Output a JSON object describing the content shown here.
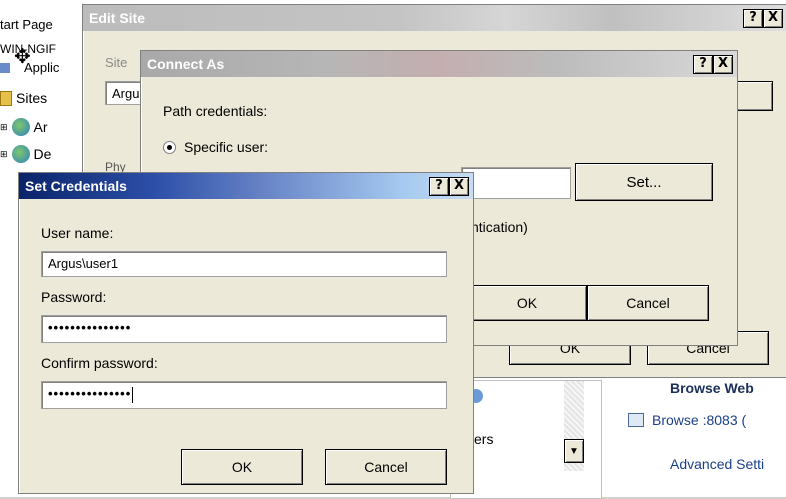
{
  "background": {
    "tree": {
      "start_page": "tart Page",
      "server": "WIN-NGIF",
      "app_pools": "Applic",
      "sites": "Sites",
      "site1": "Ar",
      "site2": "De"
    },
    "right_panel": {
      "browse_header": "Browse Web",
      "browse_link": "Browse :8083 (",
      "advanced_link": "Advanced Setti"
    },
    "list_text": "sers"
  },
  "edit_site": {
    "title": "Edit Site",
    "help_btn": "?",
    "close_btn": "X",
    "site_label": "Site",
    "site_value": "Argu",
    "phys_label": "Phy",
    "ok": "OK",
    "cancel": "Cancel"
  },
  "connect_as": {
    "title": "Connect As",
    "help_btn": "?",
    "close_btn": "X",
    "path_label": "Path credentials:",
    "specific_user_label": "Specific user:",
    "pass_through_partial": "ntication)",
    "set_button": "Set...",
    "ok": "OK",
    "cancel": "Cancel"
  },
  "set_credentials": {
    "title": "Set Credentials",
    "help_btn": "?",
    "close_btn": "X",
    "username_label": "User name:",
    "username_value": "Argus\\user1",
    "password_label": "Password:",
    "password_value": "•••••••••••••••",
    "confirm_label": "Confirm password:",
    "confirm_value": "•••••••••••••••",
    "ok": "OK",
    "cancel": "Cancel"
  }
}
